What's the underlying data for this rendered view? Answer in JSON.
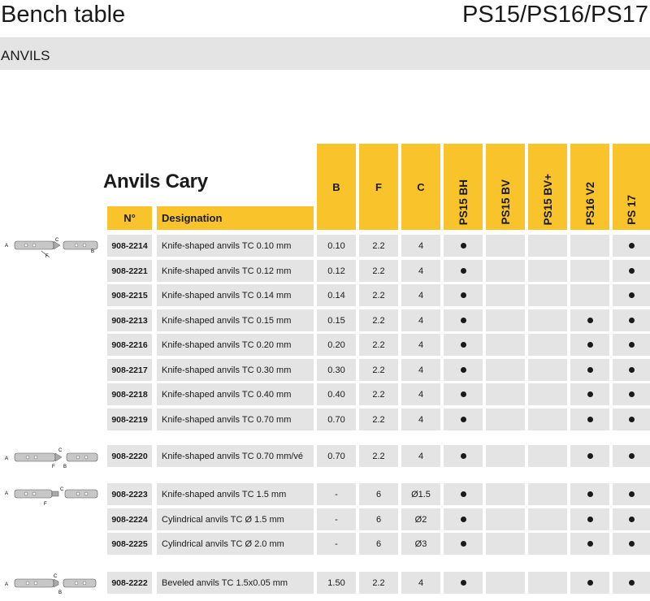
{
  "header": {
    "title": "Bench table",
    "models": "PS15/PS16/PS17"
  },
  "section": {
    "label": "ANVILS"
  },
  "table": {
    "title": "Anvils Cary",
    "col_no": "N°",
    "col_designation": "Designation",
    "col_b": "B",
    "col_f": "F",
    "col_c": "C",
    "model_cols": [
      "PS15 BH",
      "PS15 BV",
      "PS15 BV+",
      "PS16 V2",
      "PS 17"
    ],
    "rows": [
      {
        "no": "908-2214",
        "designation": "Knife-shaped anvils TC 0.10 mm",
        "b": "0.10",
        "f": "2.2",
        "c": "4",
        "marks": [
          true,
          false,
          false,
          false,
          true
        ]
      },
      {
        "no": "908-2221",
        "designation": "Knife-shaped anvils TC 0.12 mm",
        "b": "0.12",
        "f": "2.2",
        "c": "4",
        "marks": [
          true,
          false,
          false,
          false,
          true
        ]
      },
      {
        "no": "908-2215",
        "designation": "Knife-shaped anvils TC 0.14 mm",
        "b": "0.14",
        "f": "2.2",
        "c": "4",
        "marks": [
          true,
          false,
          false,
          false,
          true
        ]
      },
      {
        "no": "908-2213",
        "designation": "Knife-shaped anvils TC 0.15 mm",
        "b": "0.15",
        "f": "2.2",
        "c": "4",
        "marks": [
          true,
          false,
          false,
          true,
          true
        ]
      },
      {
        "no": "908-2216",
        "designation": "Knife-shaped anvils TC 0.20 mm",
        "b": "0.20",
        "f": "2.2",
        "c": "4",
        "marks": [
          true,
          false,
          false,
          true,
          true
        ]
      },
      {
        "no": "908-2217",
        "designation": "Knife-shaped anvils TC 0.30 mm",
        "b": "0.30",
        "f": "2.2",
        "c": "4",
        "marks": [
          true,
          false,
          false,
          true,
          true
        ]
      },
      {
        "no": "908-2218",
        "designation": "Knife-shaped anvils TC 0.40 mm",
        "b": "0.40",
        "f": "2.2",
        "c": "4",
        "marks": [
          true,
          false,
          false,
          true,
          true
        ]
      },
      {
        "no": "908-2219",
        "designation": "Knife-shaped anvils TC 0.70 mm",
        "b": "0.70",
        "f": "2.2",
        "c": "4",
        "marks": [
          true,
          false,
          false,
          true,
          true
        ]
      },
      {
        "no": "908-2220",
        "designation": "Knife-shaped anvils TC 0.70 mm/vé",
        "b": "0.70",
        "f": "2.2",
        "c": "4",
        "marks": [
          true,
          false,
          false,
          true,
          true
        ]
      },
      {
        "no": "908-2223",
        "designation": "Knife-shaped anvils TC 1.5 mm",
        "b": "-",
        "f": "6",
        "c": "Ø1.5",
        "marks": [
          true,
          false,
          false,
          true,
          true
        ]
      },
      {
        "no": "908-2224",
        "designation": "Cylindrical anvils TC Ø 1.5 mm",
        "b": "-",
        "f": "6",
        "c": "Ø2",
        "marks": [
          true,
          false,
          false,
          true,
          true
        ]
      },
      {
        "no": "908-2225",
        "designation": "Cylindrical anvils TC Ø 2.0 mm",
        "b": "-",
        "f": "6",
        "c": "Ø3",
        "marks": [
          true,
          false,
          false,
          true,
          true
        ]
      },
      {
        "no": "908-2222",
        "designation": "Beveled anvils TC 1.5x0.05 mm",
        "b": "1.50",
        "f": "2.2",
        "c": "4",
        "marks": [
          true,
          false,
          false,
          true,
          true
        ]
      }
    ]
  },
  "diagram_labels": {
    "a": "A",
    "b": "B",
    "c": "C",
    "f": "F"
  },
  "colors": {
    "accent": "#f9c32b",
    "row_bg": "#e4e4e4",
    "section_bg": "#e4e4e4"
  }
}
